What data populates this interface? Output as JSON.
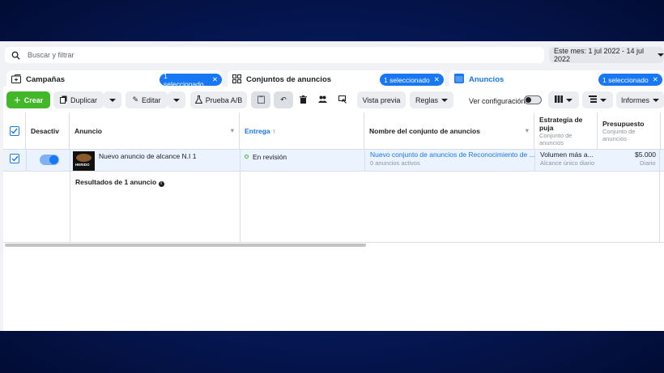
{
  "search": {
    "placeholder": "Buscar y filtrar"
  },
  "date_range": {
    "label": "Este mes: 1 jul 2022 - 14 jul 2022"
  },
  "tabs": [
    {
      "label": "Campañas",
      "pill": "1 seleccionado"
    },
    {
      "label": "Conjuntos de anuncios",
      "pill": "1 seleccionado"
    },
    {
      "label": "Anuncios",
      "pill": "1 seleccionado"
    }
  ],
  "toolbar": {
    "create": "Crear",
    "duplicate": "Duplicar",
    "edit": "Editar",
    "ab_test": "Prueba A/B",
    "preview": "Vista previa",
    "rules": "Reglas",
    "view_setup": "Ver configuración",
    "reports": "Informes"
  },
  "columns": {
    "deactivate": "Desactiv",
    "ad": "Anuncio",
    "delivery": "Entrega ↑",
    "adset_name": "Nombre del conjunto de anuncios",
    "bid_strategy": "Estrategia de puja",
    "bid_strategy_sub": "Conjunto de anuncios",
    "budget": "Presupuesto",
    "budget_sub": "Conjunto de anuncios"
  },
  "row": {
    "ad_name": "Nuevo anuncio de alcance N.I 1",
    "delivery": "En revisión",
    "adset_link": "Nuevo conjunto de anuncios de Reconocimiento de ...",
    "adset_sub": "0 anuncios activos",
    "bid": "Volumen más a...",
    "bid_sub": "Alcance único diario",
    "budget": "$5.000",
    "budget_sub": "Diario",
    "thumb_text": "HERIDO"
  },
  "results": {
    "label": "Resultados de 1 anuncio"
  },
  "colors": {
    "accent": "#1877f2",
    "create": "#42b72a",
    "delivery_dot": "#42b72a"
  }
}
